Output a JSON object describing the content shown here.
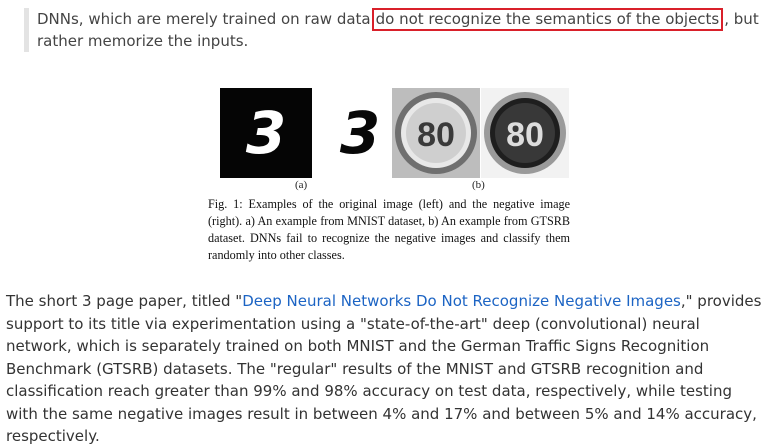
{
  "quote": {
    "before": "DNNs, which are merely trained on raw data",
    "highlighted": "do not recognize the semantics of the objects",
    "after": ", but rather memorize the inputs."
  },
  "figure": {
    "image_a_original_digit": "3",
    "image_a_negative_digit": "3",
    "image_b_original_sign": "80",
    "image_b_negative_sign": "80",
    "label_a": "(a)",
    "label_b": "(b)",
    "caption": "Fig. 1: Examples of the original image (left) and the negative image (right). a) An example from MNIST dataset, b) An example from GTSRB dataset. DNNs fail to recognize the negative images and classify them randomly into other classes."
  },
  "paragraph": {
    "before_link": "The short 3 page paper, titled \"",
    "link_text": "Deep Neural Networks Do Not Recognize Negative Images",
    "after_link": ",\" provides support to its title via experimentation using a \"state-of-the-art\" deep (convolutional) neural network, which is separately trained on both MNIST and the German Traffic Signs Recognition Benchmark (GTSRB) datasets. The \"regular\" results of the MNIST and GTSRB recognition and classification reach greater than 99% and 98% accuracy on test data, respectively, while testing with the same negative images result in between 4% and 17% and between 5% and 14% accuracy, respectively."
  },
  "colors": {
    "highlight_border": "#d9202a",
    "link": "#1c64c4",
    "quote_bar": "#e3e3e3"
  }
}
